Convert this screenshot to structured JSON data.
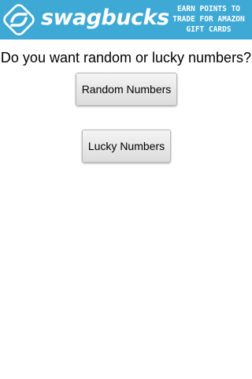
{
  "ad": {
    "brand": "swagbucks",
    "tagline": [
      "EARN POINTS TO",
      "TRADE FOR AMAZON",
      "GIFT CARDS"
    ],
    "colors": {
      "background": "#3fa9d6",
      "text": "#ffffff"
    },
    "logo_icon": "swagbucks-logo-icon"
  },
  "main": {
    "question": "Do you want random or lucky numbers?",
    "buttons": {
      "random_label": "Random Numbers",
      "lucky_label": "Lucky Numbers"
    }
  }
}
